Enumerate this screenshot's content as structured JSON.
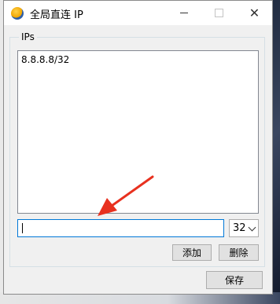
{
  "window": {
    "title": "全局直连 IP",
    "minimize_icon": "minimize-icon",
    "maximize_icon": "maximize-icon",
    "close_glyph": "✕"
  },
  "group": {
    "label": "IPs"
  },
  "ip_list": {
    "items": [
      "8.8.8.8/32"
    ]
  },
  "ip_input": {
    "value": "",
    "placeholder": ""
  },
  "prefix_select": {
    "selected": "32"
  },
  "buttons": {
    "add": "添加",
    "delete": "删除",
    "save": "保存"
  },
  "annotation": {
    "color": "#e8311f"
  }
}
